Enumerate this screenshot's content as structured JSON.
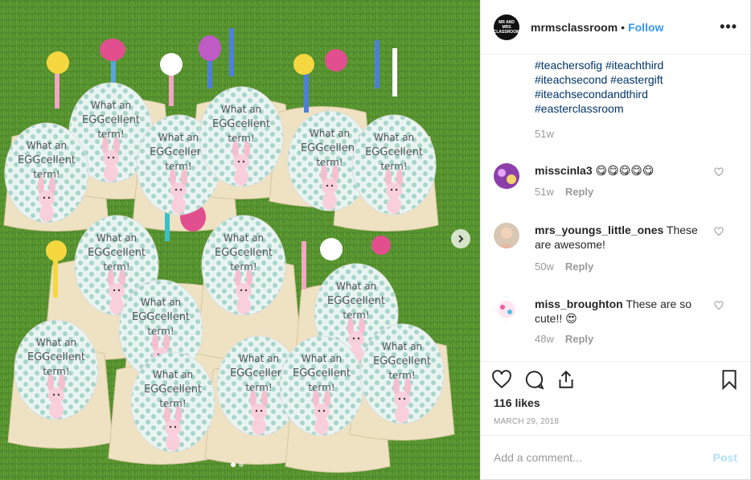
{
  "post": {
    "image_alt": "What an EGGcellent term!",
    "image_tag_text": "What an EGGcellent term!",
    "carousel_dots": 2,
    "carousel_active": 0
  },
  "header": {
    "username": "mrmsclassroom",
    "separator": "•",
    "follow_label": "Follow",
    "more_label": "•••",
    "avatar_text": "MR AND MRS CLASSROOM"
  },
  "caption": {
    "lines": [
      "#teachersofig #iteachthird",
      "#iteachsecond #eastergift",
      "#iteachsecondandthird",
      "#easterclassroom"
    ],
    "time": "51w"
  },
  "comments": [
    {
      "username": "misscinla3",
      "text": "😋😋😋😋😋",
      "time": "51w",
      "reply_label": "Reply"
    },
    {
      "username": "mrs_youngs_little_ones",
      "text": "These are awesome!",
      "time": "50w",
      "reply_label": "Reply"
    },
    {
      "username": "miss_broughton",
      "text": "These are so cute!! 😍",
      "time": "48w",
      "reply_label": "Reply"
    }
  ],
  "likes": "116 likes",
  "date": "MARCH 29, 2018",
  "add_comment": {
    "placeholder": "Add a comment...",
    "post_label": "Post"
  },
  "colors": {
    "link": "#3897f0",
    "hashtag": "#003569",
    "muted": "#999999",
    "grass": "#4f8a2b"
  }
}
